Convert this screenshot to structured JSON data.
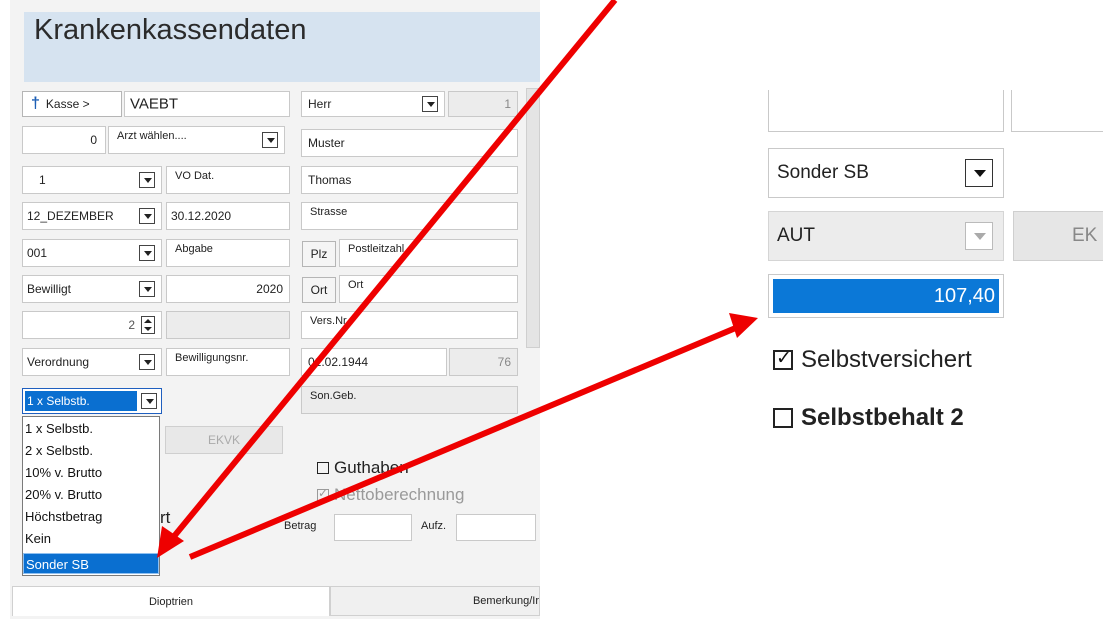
{
  "header": {
    "title": "Krankenkassendaten"
  },
  "kasse": {
    "button_label": "Kasse >",
    "value": "VAEBT"
  },
  "arzt": {
    "number": "0",
    "placeholder": "Arzt wählen...."
  },
  "left_column": {
    "row_1": {
      "value": "1",
      "label": "VO Dat."
    },
    "row_2": {
      "value": "12_DEZEMBER",
      "date": "30.12.2020"
    },
    "row_3": {
      "value": "001",
      "label": "Abgabe"
    },
    "row_4": {
      "value": "Bewilligt",
      "year": "2020"
    },
    "row_5": {
      "value": "2"
    },
    "row_6": {
      "value": "Verordnung",
      "label": "Bewilligungsnr."
    },
    "row_7": {
      "value": "1 x Selbstb."
    }
  },
  "right_column": {
    "anrede": "Herr",
    "anrede_number": "1",
    "nachname": "Muster",
    "vorname": "Thomas",
    "strasse": "Strasse",
    "plz_button": "Plz",
    "postleitzahl": "Postleitzahl",
    "ort_button": "Ort",
    "ort": "Ort",
    "versnr": "Vers.Nr.",
    "geburtsdatum": "01.02.1944",
    "alter": "76",
    "songeb": "Son.Geb."
  },
  "dropdown_options": [
    "1 x Selbstb.",
    "2 x Selbstb.",
    "10% v. Brutto",
    "20% v. Brutto",
    "Höchstbetrag",
    "Kein",
    "Sonder SB"
  ],
  "dropdown_selected": "Sonder SB",
  "ekvk_button": "EKVK",
  "guthaben_label": "Guthaben",
  "nettoberechnung_label": "Nettoberechnung",
  "partial_label": "rt",
  "betrag_label": "Betrag",
  "aufz_label": "Aufz.",
  "tabs": [
    "Dioptrien",
    "Bemerkung/Ir"
  ],
  "zoom": {
    "sonder_value": "Sonder SB",
    "aut_value": "AUT",
    "ek_button": "EK",
    "amount": "107,40",
    "selbstversichert": {
      "label": "Selbstversichert",
      "checked": true
    },
    "selbstbehalt2": {
      "label": "Selbstbehalt 2",
      "checked": false
    }
  },
  "colors": {
    "accent": "#0a6fd0",
    "arrow": "#ee0000",
    "header_bg": "#d6e3f0",
    "zoom_amount_bg": "#0b78d7"
  }
}
